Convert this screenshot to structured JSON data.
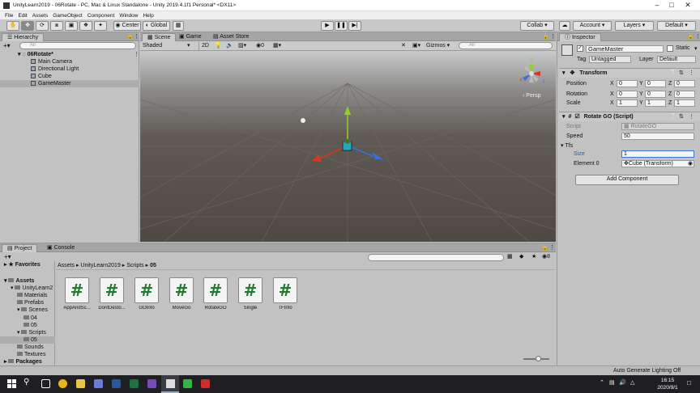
{
  "window": {
    "title": "UnityLearn2019 - 06Rotate - PC, Mac & Linux Standalone - Unity 2019.4.1f1 Personal* <DX11>"
  },
  "menu": [
    "File",
    "Edit",
    "Assets",
    "GameObject",
    "Component",
    "Window",
    "Help"
  ],
  "toolbar": {
    "pivot": "Center",
    "space": "Global",
    "collab": "Collab ▾",
    "account": "Account",
    "layers": "Layers",
    "layout": "Default"
  },
  "hierarchy": {
    "tab": "Hierarchy",
    "search_placeholder": "All",
    "scene": "06Rotate*",
    "items": [
      "Main Camera",
      "Directional Light",
      "Cube",
      "GameMaster"
    ]
  },
  "scene": {
    "tabs": [
      "Scene",
      "Game",
      "Asset Store"
    ],
    "shading": "Shaded",
    "mode2d": "2D",
    "fx_count": "0",
    "gizmos": "Gizmos",
    "search_placeholder": "All",
    "persp": "‹ Persp",
    "gizmo_axes": [
      "x",
      "y",
      "z"
    ]
  },
  "inspector": {
    "tab": "Inspector",
    "object_name": "GameMaster",
    "static_label": "Static",
    "tag_label": "Tag",
    "tag_value": "Untagged",
    "layer_label": "Layer",
    "layer_value": "Default",
    "transform": {
      "title": "Transform",
      "rows": [
        {
          "label": "Position",
          "x": "0",
          "y": "0",
          "z": "0"
        },
        {
          "label": "Rotation",
          "x": "0",
          "y": "0",
          "z": "0"
        },
        {
          "label": "Scale",
          "x": "1",
          "y": "1",
          "z": "1"
        }
      ],
      "axis_labels": [
        "X",
        "Y",
        "Z"
      ]
    },
    "script": {
      "title": "Rotate GO (Script)",
      "script_label": "Script",
      "script_value": "RotateGO",
      "speed_label": "Speed",
      "speed_value": "50",
      "tfs_label": "Tfs",
      "size_label": "Size",
      "size_value": "1",
      "element_label": "Element 0",
      "element_value": "Cube (Transform)"
    },
    "add_component": "Add Component"
  },
  "project": {
    "tabs": [
      "Project",
      "Console"
    ],
    "breadcrumb": [
      "Assets",
      "UnityLearn2019",
      "Scripts",
      "05"
    ],
    "favorites": "Favorites",
    "tree": [
      {
        "label": "Assets",
        "level": 0,
        "bold": true
      },
      {
        "label": "UnityLearn2",
        "level": 1
      },
      {
        "label": "Materials",
        "level": 2
      },
      {
        "label": "Prefabs",
        "level": 2
      },
      {
        "label": "Scenes",
        "level": 2
      },
      {
        "label": "04",
        "level": 3
      },
      {
        "label": "05",
        "level": 3
      },
      {
        "label": "Scripts",
        "level": 2
      },
      {
        "label": "05",
        "level": 3,
        "selected": true
      },
      {
        "label": "Sounds",
        "level": 2
      },
      {
        "label": "Textures",
        "level": 2
      },
      {
        "label": "Packages",
        "level": 0,
        "bold": true
      }
    ],
    "assets": [
      "AppAndSc...",
      "DontDesto...",
      "GOInfo",
      "MoveGo",
      "RotateGO",
      "Single",
      "TFInfo"
    ],
    "hidden_count": "8"
  },
  "status": {
    "text": "Auto Generate Lighting Off"
  },
  "taskbar": {
    "time": "16:15",
    "date": "2020/9/1"
  },
  "colors": {
    "scene_bg": "#565048",
    "x_axis": "#d9371f",
    "y_axis": "#8fd12a",
    "z_axis": "#3a6fe0",
    "taskbar": "#1f1f23"
  }
}
